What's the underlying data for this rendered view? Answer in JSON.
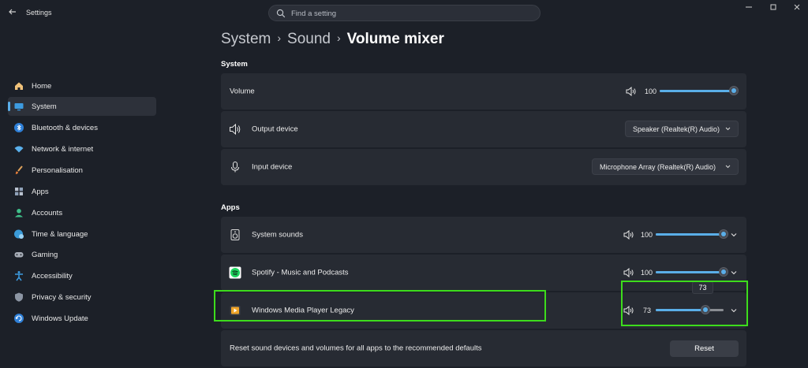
{
  "window": {
    "title": "Settings",
    "back_icon": "back-arrow-icon"
  },
  "search": {
    "placeholder": "Find a setting"
  },
  "sidebar": {
    "items": [
      {
        "label": "Home",
        "icon": "home-icon"
      },
      {
        "label": "System",
        "icon": "system-icon",
        "active": true
      },
      {
        "label": "Bluetooth & devices",
        "icon": "bluetooth-icon"
      },
      {
        "label": "Network & internet",
        "icon": "wifi-icon"
      },
      {
        "label": "Personalisation",
        "icon": "brush-icon"
      },
      {
        "label": "Apps",
        "icon": "apps-icon"
      },
      {
        "label": "Accounts",
        "icon": "account-icon"
      },
      {
        "label": "Time & language",
        "icon": "globe-clock-icon"
      },
      {
        "label": "Gaming",
        "icon": "gamepad-icon"
      },
      {
        "label": "Accessibility",
        "icon": "accessibility-icon"
      },
      {
        "label": "Privacy & security",
        "icon": "shield-icon"
      },
      {
        "label": "Windows Update",
        "icon": "update-icon"
      }
    ]
  },
  "breadcrumb": {
    "items": [
      "System",
      "Sound"
    ],
    "current": "Volume mixer"
  },
  "system_section": {
    "label": "System",
    "volume": {
      "label": "Volume",
      "value": 100,
      "value_text": "100"
    },
    "output": {
      "label": "Output device",
      "selected": "Speaker (Realtek(R) Audio)"
    },
    "input": {
      "label": "Input device",
      "selected": "Microphone Array (Realtek(R) Audio)"
    }
  },
  "apps_section": {
    "label": "Apps",
    "apps": [
      {
        "name": "System sounds",
        "icon": "system-sounds-icon",
        "value": 100,
        "value_text": "100"
      },
      {
        "name": "Spotify - Music and Podcasts",
        "icon": "spotify-icon",
        "value": 100,
        "value_text": "100"
      },
      {
        "name": "Windows Media Player Legacy",
        "icon": "media-player-icon",
        "value": 73,
        "value_text": "73"
      }
    ],
    "tooltip": "73"
  },
  "reset": {
    "description": "Reset sound devices and volumes for all apps to the recommended defaults",
    "button_label": "Reset"
  },
  "colors": {
    "background": "#1c2028",
    "card": "#272b33",
    "accent": "#5aaee8",
    "highlight": "#3ddc1c"
  }
}
